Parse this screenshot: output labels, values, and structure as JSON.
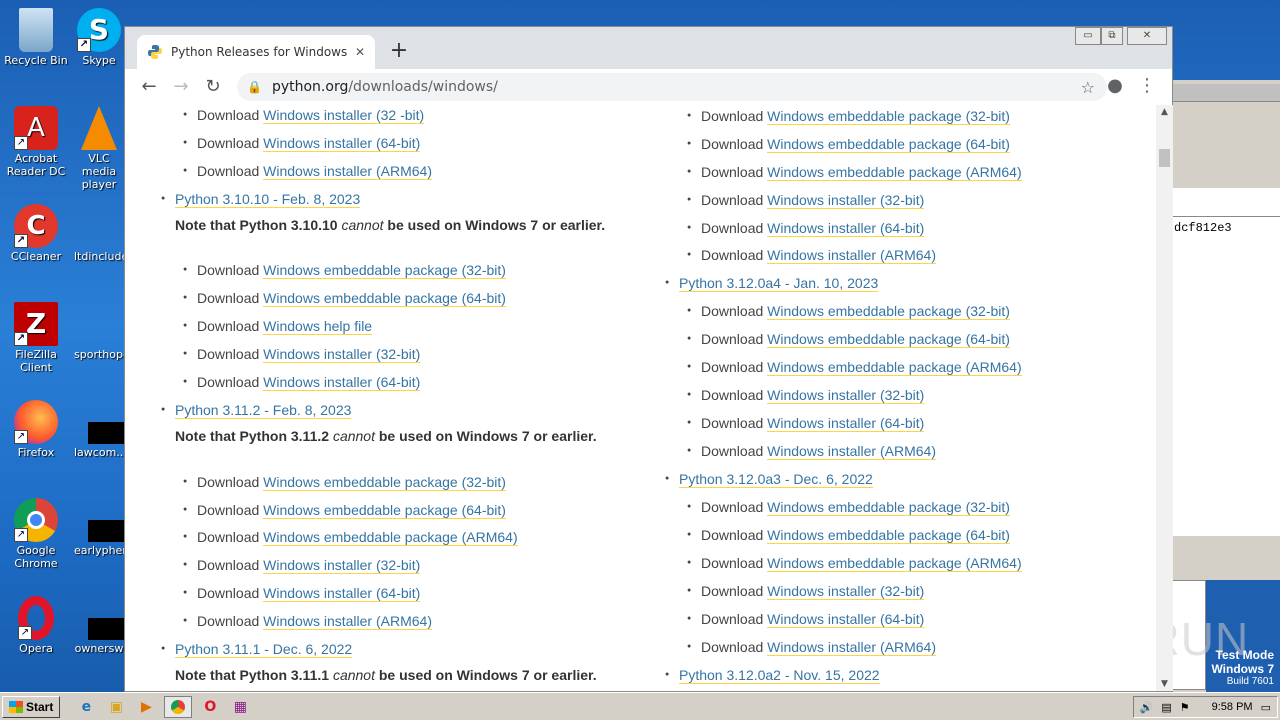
{
  "desktop": {
    "icons": [
      {
        "label": "Recycle Bin"
      },
      {
        "label": "Skype"
      },
      {
        "label": "Acrobat Reader DC"
      },
      {
        "label": "VLC media player"
      },
      {
        "label": "CCleaner"
      },
      {
        "label": "ltdinclude"
      },
      {
        "label": "FileZilla Client"
      },
      {
        "label": "sporthope"
      },
      {
        "label": "Firefox"
      },
      {
        "label": "lawcom..."
      },
      {
        "label": "Google Chrome"
      },
      {
        "label": "earlyphen"
      },
      {
        "label": "Opera"
      },
      {
        "label": "ownersw"
      }
    ],
    "bgapp_text": "dcf812e3",
    "watermark": {
      "line1": "Test Mode",
      "line2": "Windows 7",
      "line3": "Build 7601"
    },
    "anyrun": "ANY RUN"
  },
  "browser": {
    "tab_title": "Python Releases for Windows | Pyth",
    "url_host": "python.org",
    "url_path": "/downloads/windows/",
    "win_min": "▭",
    "win_max": "⧉",
    "win_close": "✕"
  },
  "page": {
    "download": "Download",
    "left": {
      "top_items": [
        "Windows installer (32 -bit)",
        "Windows installer (64-bit)",
        "Windows installer (ARM64)"
      ],
      "rel1": "Python 3.10.10 - Feb. 8, 2023",
      "note1_pre": "Note that Python 3.10.10 ",
      "note_cannot": "cannot",
      "note_post": " be used on Windows 7 or earlier.",
      "rel1_items": [
        "Windows embeddable package (32-bit)",
        "Windows embeddable package (64-bit)",
        "Windows help file",
        "Windows installer (32-bit)",
        "Windows installer (64-bit)"
      ],
      "rel2": "Python 3.11.2 - Feb. 8, 2023",
      "note2_pre": "Note that Python 3.11.2 ",
      "rel2_items": [
        "Windows embeddable package (32-bit)",
        "Windows embeddable package (64-bit)",
        "Windows embeddable package (ARM64)",
        "Windows installer (32-bit)",
        "Windows installer (64-bit)",
        "Windows installer (ARM64)"
      ],
      "rel3": "Python 3.11.1 - Dec. 6, 2022",
      "note3_pre": "Note that Python 3.11.1 "
    },
    "right": {
      "top_items": [
        "Windows embeddable package (32-bit)",
        "Windows embeddable package (64-bit)",
        "Windows embeddable package (ARM64)",
        "Windows installer (32-bit)",
        "Windows installer (64-bit)",
        "Windows installer (ARM64)"
      ],
      "rel1": "Python 3.12.0a4 - Jan. 10, 2023",
      "rel1_items": [
        "Windows embeddable package (32-bit)",
        "Windows embeddable package (64-bit)",
        "Windows embeddable package (ARM64)",
        "Windows installer (32-bit)",
        "Windows installer (64-bit)",
        "Windows installer (ARM64)"
      ],
      "rel2": "Python 3.12.0a3 - Dec. 6, 2022",
      "rel2_items": [
        "Windows embeddable package (32-bit)",
        "Windows embeddable package (64-bit)",
        "Windows embeddable package (ARM64)",
        "Windows installer (32-bit)",
        "Windows installer (64-bit)",
        "Windows installer (ARM64)"
      ],
      "rel3": "Python 3.12.0a2 - Nov. 15, 2022"
    }
  },
  "taskbar": {
    "start": "Start",
    "clock": "9:58 PM"
  }
}
